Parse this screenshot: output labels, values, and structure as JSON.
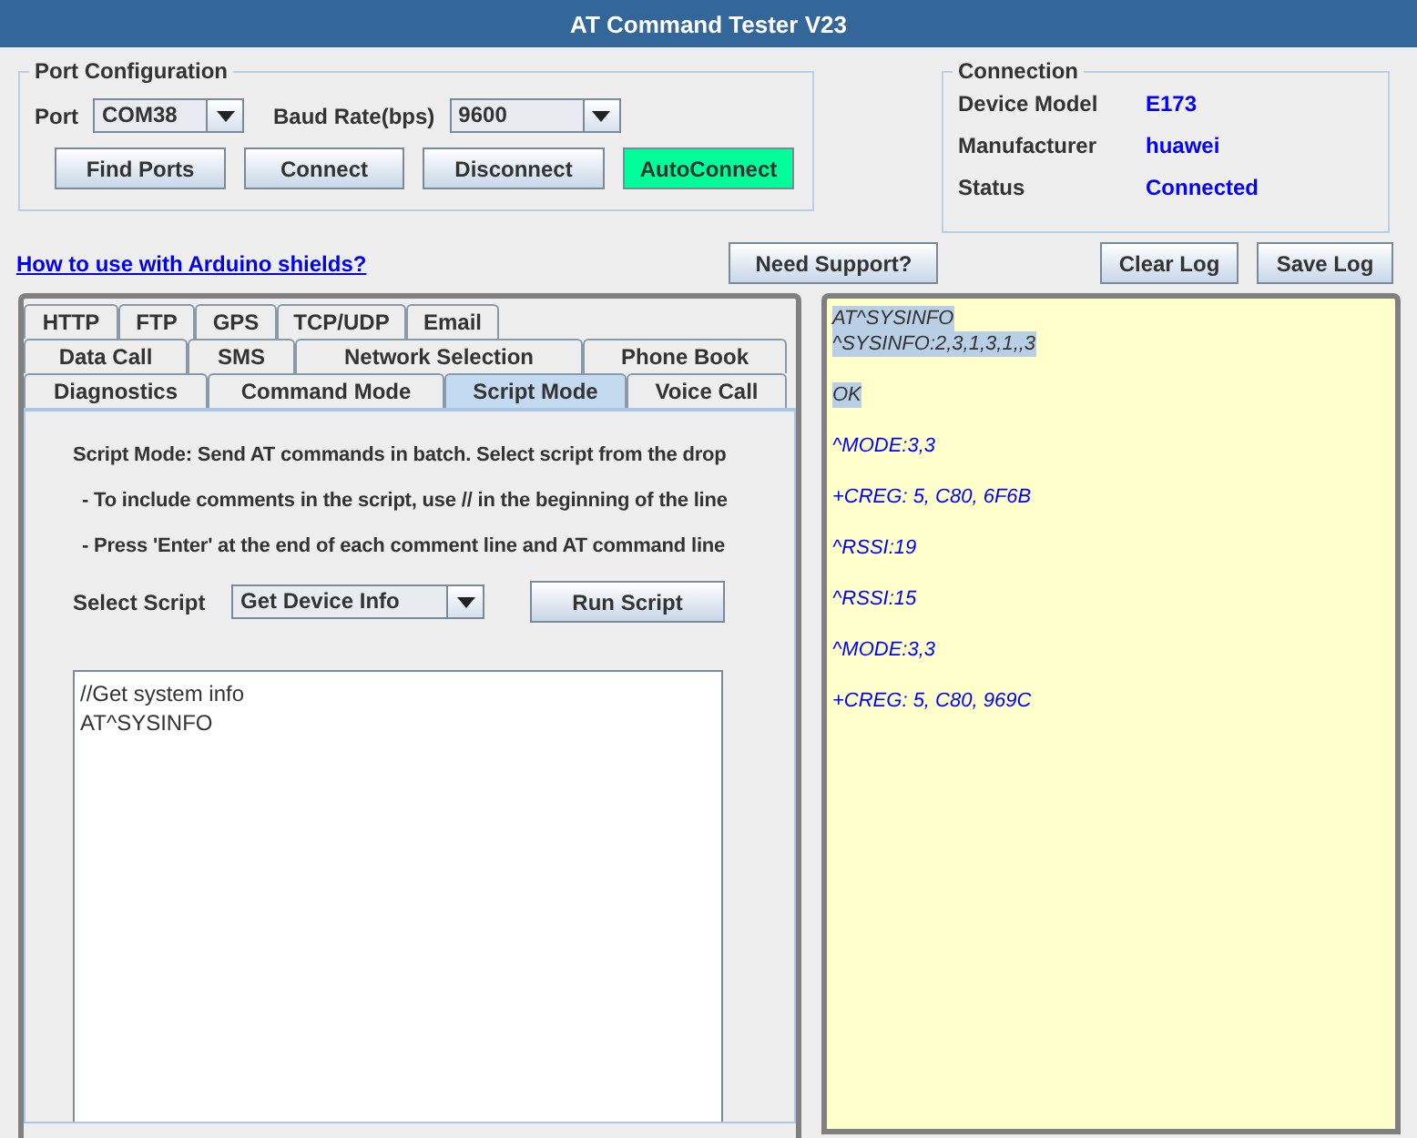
{
  "window": {
    "title": "AT Command Tester V23"
  },
  "port_configuration": {
    "title": "Port Configuration",
    "port_label": "Port",
    "port": "COM38",
    "baud_label": "Baud Rate(bps)",
    "baud": "9600",
    "buttons": [
      {
        "label": "Find Ports",
        "kind": "normal"
      },
      {
        "label": "Connect",
        "kind": "normal"
      },
      {
        "label": "Disconnect",
        "kind": "normal"
      },
      {
        "label": "AutoConnect",
        "kind": "highlight"
      }
    ]
  },
  "connection": {
    "title": "Connection",
    "fields": [
      {
        "label": "Device Model",
        "value": "E173"
      },
      {
        "label": "Manufacturer",
        "value": "huawei"
      },
      {
        "label": "Status",
        "value": "Connected"
      }
    ]
  },
  "help_link": "How to use with Arduino shields?",
  "support_button": "Need Support?",
  "log_buttons": [
    "Clear Log",
    "Save Log"
  ],
  "tab_rows": [
    [
      {
        "label": "HTTP",
        "selected": false
      },
      {
        "label": "FTP",
        "selected": false
      },
      {
        "label": "GPS",
        "selected": false
      },
      {
        "label": "TCP/UDP",
        "selected": false
      },
      {
        "label": "Email",
        "selected": false
      }
    ],
    [
      {
        "label": "Data Call",
        "selected": false
      },
      {
        "label": "SMS",
        "selected": false
      },
      {
        "label": "Network Selection",
        "selected": false
      },
      {
        "label": "Phone Book",
        "selected": false
      }
    ],
    [
      {
        "label": "Diagnostics",
        "selected": false
      },
      {
        "label": "Command Mode",
        "selected": false
      },
      {
        "label": "Script Mode",
        "selected": true
      },
      {
        "label": "Voice Call",
        "selected": false
      }
    ]
  ],
  "script_mode": {
    "instructions": [
      "Script Mode: Send AT commands in batch. Select script from the drop",
      "- To include comments in the script, use // in the beginning of the line",
      "- Press 'Enter' at the end of each comment line and AT command line"
    ],
    "select_label": "Select Script",
    "script": "Get Device Info",
    "run_button": "Run Script",
    "editor_lines": [
      "//Get system info",
      "AT^SYSINFO"
    ]
  },
  "log": [
    {
      "text": "AT^SYSINFO",
      "kind": "echo",
      "selected": true
    },
    {
      "text": "^SYSINFO:2,3,1,3,1,,3",
      "kind": "echo",
      "selected": true
    },
    {
      "text": "OK",
      "kind": "echo",
      "selected": true
    },
    {
      "text": "^MODE:3,3",
      "kind": "unsolicited",
      "selected": false
    },
    {
      "text": "+CREG: 5, C80, 6F6B",
      "kind": "unsolicited",
      "selected": false
    },
    {
      "text": "^RSSI:19",
      "kind": "unsolicited",
      "selected": false
    },
    {
      "text": "^RSSI:15",
      "kind": "unsolicited",
      "selected": false
    },
    {
      "text": "^MODE:3,3",
      "kind": "unsolicited",
      "selected": false
    },
    {
      "text": "+CREG: 5, C80, 969C",
      "kind": "unsolicited",
      "selected": false
    }
  ]
}
